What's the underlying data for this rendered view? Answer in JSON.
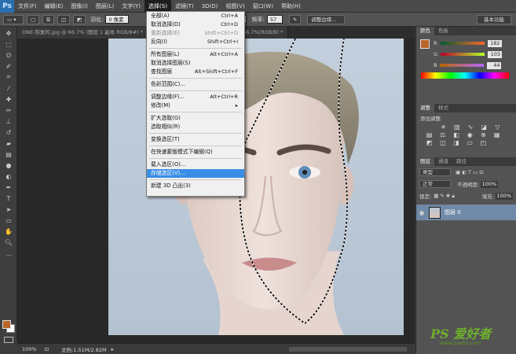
{
  "app": {
    "logo": "Ps"
  },
  "menubar": {
    "items": [
      "文件(F)",
      "编辑(E)",
      "图像(I)",
      "图层(L)",
      "文字(Y)",
      "选择(S)",
      "滤镜(T)",
      "3D(D)",
      "视图(V)",
      "窗口(W)",
      "帮助(H)"
    ],
    "active_index": 5
  },
  "options": {
    "feather_label": "羽化:",
    "feather_value": "0 像素",
    "zoom_value": "0%",
    "frequency_label": "频率:",
    "frequency_value": "57",
    "refine_edge": "调整边缘...",
    "workspace": "基本功能"
  },
  "tabs": [
    {
      "label": "ONE-恢复的.jpg @ 66.7% (图层 1 副本 RGB/8#) *",
      "active": false
    },
    {
      "label": "... RGB/8#) *",
      "active": true
    },
    {
      "label": "男人-恢复的.psd @ 66.7%(RGB/8) *",
      "active": false
    }
  ],
  "select_menu": {
    "items": [
      {
        "label": "全部(A)",
        "shortcut": "Ctrl+A",
        "disabled": false
      },
      {
        "label": "取消选择(D)",
        "shortcut": "Ctrl+D",
        "disabled": false
      },
      {
        "label": "重新选择(E)",
        "shortcut": "Shift+Ctrl+D",
        "disabled": true
      },
      {
        "label": "反向(I)",
        "shortcut": "Shift+Ctrl+I",
        "disabled": false
      },
      {
        "sep": true
      },
      {
        "label": "所有图层(L)",
        "shortcut": "Alt+Ctrl+A",
        "disabled": false
      },
      {
        "label": "取消选择图层(S)",
        "shortcut": "",
        "disabled": false
      },
      {
        "label": "查找图层",
        "shortcut": "Alt+Shift+Ctrl+F",
        "disabled": false
      },
      {
        "sep": true
      },
      {
        "label": "色彩范围(C)...",
        "shortcut": "",
        "disabled": false
      },
      {
        "sep": true
      },
      {
        "label": "调整边缘(F)...",
        "shortcut": "Alt+Ctrl+R",
        "disabled": false
      },
      {
        "label": "修改(M)",
        "shortcut": "",
        "submenu": true,
        "disabled": false
      },
      {
        "sep": true
      },
      {
        "label": "扩大选取(G)",
        "shortcut": "",
        "disabled": false
      },
      {
        "label": "选取相似(R)",
        "shortcut": "",
        "disabled": false
      },
      {
        "sep": true
      },
      {
        "label": "变换选区(T)",
        "shortcut": "",
        "disabled": false
      },
      {
        "sep": true
      },
      {
        "label": "在快速蒙版模式下编辑(Q)",
        "shortcut": "",
        "disabled": false
      },
      {
        "sep": true
      },
      {
        "label": "载入选区(O)...",
        "shortcut": "",
        "disabled": false
      },
      {
        "label": "存储选区(V)...",
        "shortcut": "",
        "disabled": false,
        "highlight": true
      },
      {
        "sep": true
      },
      {
        "label": "新建 3D 凸出(3)",
        "shortcut": "",
        "disabled": false
      }
    ]
  },
  "status": {
    "zoom": "100%",
    "doc_info": "文档:1.51M/2.82M"
  },
  "color_panel": {
    "tabs": [
      "颜色",
      "色板"
    ],
    "r": "182",
    "g": "103",
    "b": "44",
    "r_label": "R",
    "g_label": "G",
    "b_label": "B",
    "fg_color": "#b8662b"
  },
  "adjust_panel": {
    "tabs": [
      "调整",
      "样式"
    ],
    "title": "添加调整"
  },
  "layers_panel": {
    "tabs": [
      "图层",
      "通道",
      "路径"
    ],
    "kind_label": "类型",
    "blend_mode": "正常",
    "opacity_label": "不透明度:",
    "opacity_value": "100%",
    "lock_label": "锁定:",
    "fill_label": "填充:",
    "fill_value": "100%",
    "layer_name": "图层 0"
  },
  "watermark": {
    "logo": "PS 爱好者",
    "url": "www.psahz.com"
  }
}
